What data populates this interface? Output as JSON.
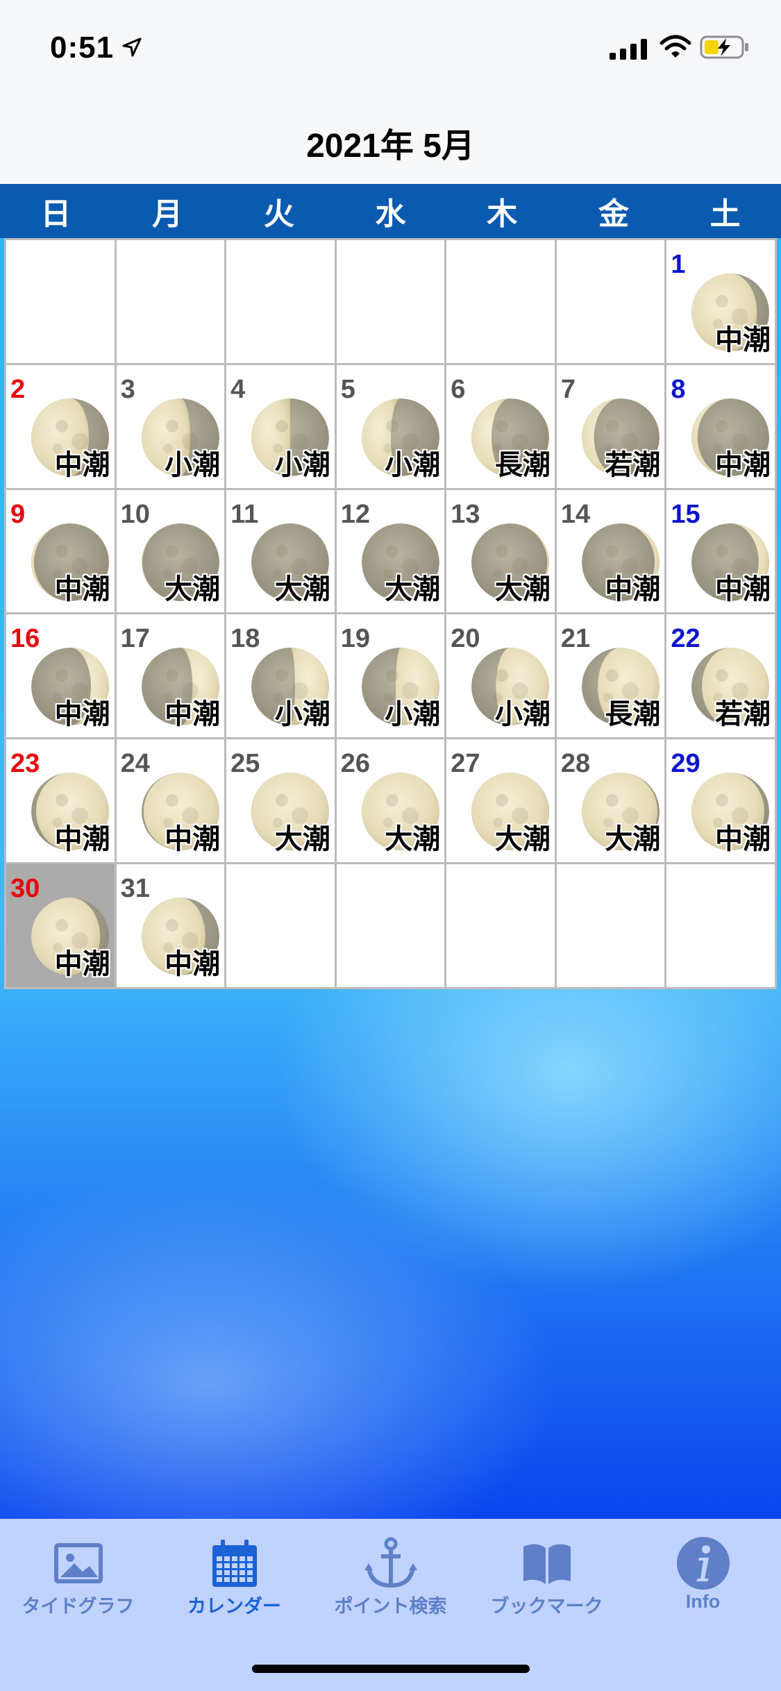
{
  "status_bar": {
    "time": "0:51",
    "location_icon": "location-arrow-icon",
    "signal_icon": "cellular-signal-icon",
    "wifi_icon": "wifi-icon",
    "battery_icon": "battery-charging-icon"
  },
  "header": {
    "title": "2021年 5月"
  },
  "weekdays": [
    "日",
    "月",
    "火",
    "水",
    "木",
    "金",
    "土"
  ],
  "colors": {
    "weekday_bar": "#0a5ab0",
    "sunday": "#e8000b",
    "saturday": "#0a14cc",
    "selected_cell": "#ababab",
    "tab_active": "#1a62d6",
    "tab_inactive": "#5f80c8"
  },
  "calendar": {
    "first_weekday_index": 6,
    "selected_day": 30,
    "days": [
      {
        "day": "1",
        "tide": "中潮",
        "phase": 0.63
      },
      {
        "day": "2",
        "tide": "中潮",
        "phase": 0.67
      },
      {
        "day": "3",
        "tide": "小潮",
        "phase": 0.71
      },
      {
        "day": "4",
        "tide": "小潮",
        "phase": 0.75
      },
      {
        "day": "5",
        "tide": "小潮",
        "phase": 0.79
      },
      {
        "day": "6",
        "tide": "長潮",
        "phase": 0.83
      },
      {
        "day": "7",
        "tide": "若潮",
        "phase": 0.87
      },
      {
        "day": "8",
        "tide": "中潮",
        "phase": 0.91
      },
      {
        "day": "9",
        "tide": "中潮",
        "phase": 0.94
      },
      {
        "day": "10",
        "tide": "大潮",
        "phase": 0.97
      },
      {
        "day": "11",
        "tide": "大潮",
        "phase": 0.0
      },
      {
        "day": "12",
        "tide": "大潮",
        "phase": 0.02
      },
      {
        "day": "13",
        "tide": "大潮",
        "phase": 0.05
      },
      {
        "day": "14",
        "tide": "中潮",
        "phase": 0.08
      },
      {
        "day": "15",
        "tide": "中潮",
        "phase": 0.12
      },
      {
        "day": "16",
        "tide": "中潮",
        "phase": 0.16
      },
      {
        "day": "17",
        "tide": "中潮",
        "phase": 0.2
      },
      {
        "day": "18",
        "tide": "小潮",
        "phase": 0.23
      },
      {
        "day": "19",
        "tide": "小潮",
        "phase": 0.27
      },
      {
        "day": "20",
        "tide": "小潮",
        "phase": 0.31
      },
      {
        "day": "21",
        "tide": "長潮",
        "phase": 0.35
      },
      {
        "day": "22",
        "tide": "若潮",
        "phase": 0.38
      },
      {
        "day": "23",
        "tide": "中潮",
        "phase": 0.42
      },
      {
        "day": "24",
        "tide": "中潮",
        "phase": 0.45
      },
      {
        "day": "25",
        "tide": "大潮",
        "phase": 0.48
      },
      {
        "day": "26",
        "tide": "大潮",
        "phase": 0.5
      },
      {
        "day": "27",
        "tide": "大潮",
        "phase": 0.52
      },
      {
        "day": "28",
        "tide": "大潮",
        "phase": 0.55
      },
      {
        "day": "29",
        "tide": "中潮",
        "phase": 0.58
      },
      {
        "day": "30",
        "tide": "中潮",
        "phase": 0.61
      },
      {
        "day": "31",
        "tide": "中潮",
        "phase": 0.64
      }
    ]
  },
  "tabs": [
    {
      "label": "タイドグラフ",
      "icon": "photo-icon",
      "active": false
    },
    {
      "label": "カレンダー",
      "icon": "calendar-icon",
      "active": true
    },
    {
      "label": "ポイント検索",
      "icon": "anchor-icon",
      "active": false
    },
    {
      "label": "ブックマーク",
      "icon": "book-icon",
      "active": false
    },
    {
      "label": "Info",
      "icon": "info-icon",
      "active": false
    }
  ]
}
